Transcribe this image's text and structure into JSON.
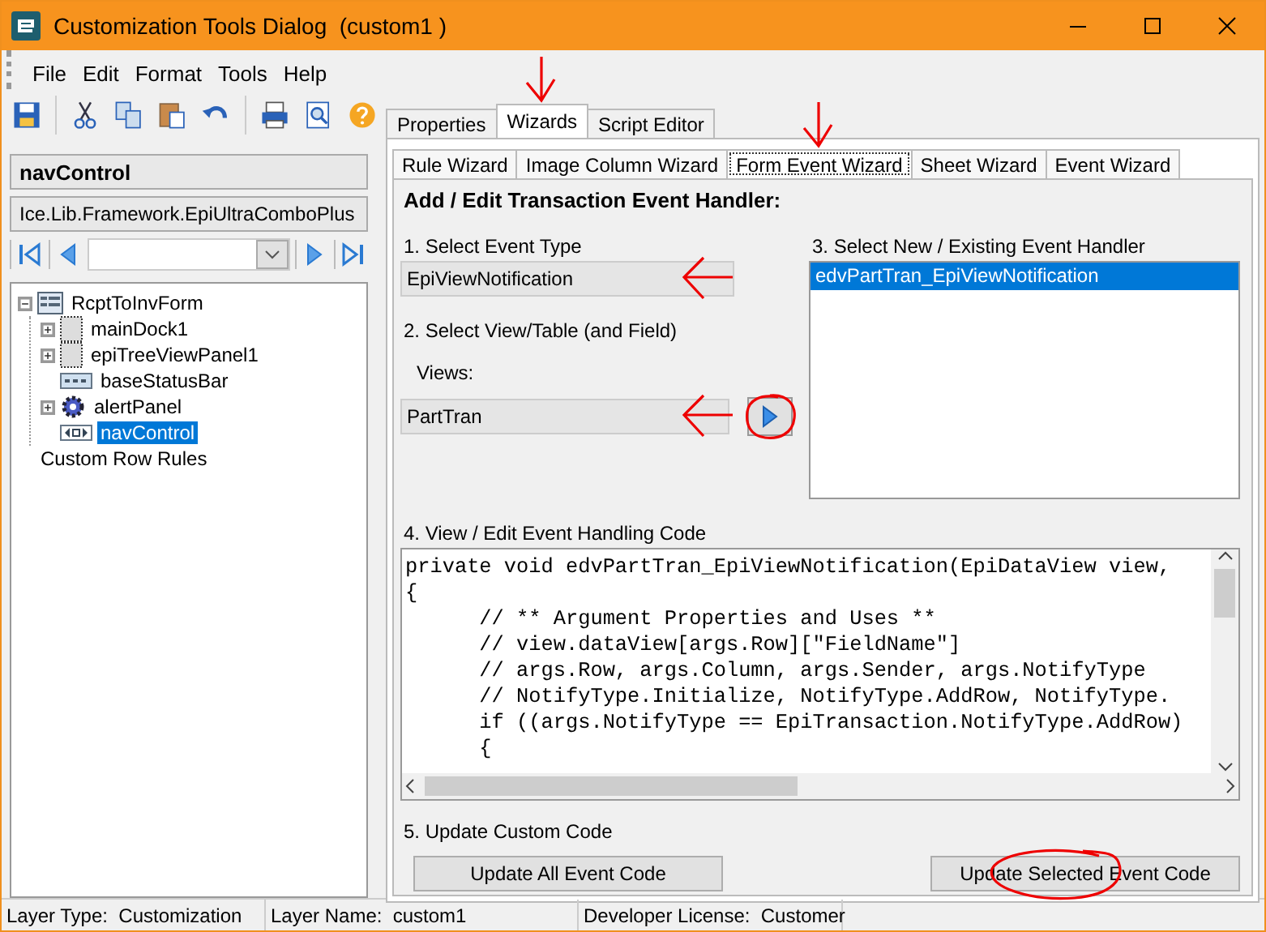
{
  "window": {
    "title": "Customization Tools Dialog  (custom1 )"
  },
  "menu": [
    "File",
    "Edit",
    "Format",
    "Tools",
    "Help"
  ],
  "left_panel": {
    "control_name": "navControl",
    "control_type": "Ice.Lib.Framework.EpiUltraComboPlus"
  },
  "tree": [
    {
      "label": "RcptToInvForm",
      "kind": "form",
      "expanded": true,
      "selected": false,
      "children": [
        {
          "label": "mainDock1",
          "kind": "panel",
          "expanded": false,
          "selected": false
        },
        {
          "label": "epiTreeViewPanel1",
          "kind": "panel",
          "expanded": false,
          "selected": false
        },
        {
          "label": "baseStatusBar",
          "kind": "statusbar",
          "selected": false
        },
        {
          "label": "alertPanel",
          "kind": "gear",
          "expanded": false,
          "selected": false
        },
        {
          "label": "navControl",
          "kind": "nav",
          "selected": true
        }
      ]
    },
    {
      "label": "Custom Row Rules",
      "kind": "text",
      "selected": false
    }
  ],
  "tabs": [
    {
      "label": "Properties",
      "selected": false,
      "marked": false
    },
    {
      "label": "Wizards",
      "selected": true,
      "marked": true
    },
    {
      "label": "Script Editor",
      "selected": false,
      "marked": false
    }
  ],
  "wizard_tabs": [
    {
      "label": "Rule Wizard",
      "selected": false,
      "marked": false
    },
    {
      "label": "Image Column Wizard",
      "selected": false,
      "marked": false
    },
    {
      "label": "Form Event Wizard",
      "selected": true,
      "marked": true
    },
    {
      "label": "Sheet Wizard",
      "selected": false,
      "marked": false
    },
    {
      "label": "Event Wizard",
      "selected": false,
      "marked": false
    }
  ],
  "wizard": {
    "heading": "Add / Edit Transaction Event Handler:",
    "event_type_label": "1. Select Event Type",
    "event_type": {
      "value": "EpiViewNotification",
      "marked": true
    },
    "view_label": "2. Select View/Table (and Field)",
    "views_label": "Views:",
    "views": {
      "value": "PartTran",
      "marked": true
    },
    "add_button_circled": true,
    "handler_label": "3. Select New / Existing Event Handler",
    "handlers": [
      {
        "label": "edvPartTran_EpiViewNotification",
        "selected": true
      }
    ],
    "code_label": "4. View / Edit Event Handling Code",
    "code_lines": [
      "private void edvPartTran_EpiViewNotification(EpiDataView view,",
      "{",
      "      // ** Argument Properties and Uses **",
      "      // view.dataView[args.Row][\"FieldName\"]",
      "      // args.Row, args.Column, args.Sender, args.NotifyType",
      "      // NotifyType.Initialize, NotifyType.AddRow, NotifyType.",
      "      if ((args.NotifyType == EpiTransaction.NotifyType.AddRow)",
      "      {"
    ],
    "update_label": "5. Update Custom Code",
    "buttons": [
      {
        "label": "Update All Event Code",
        "circled": false
      },
      {
        "label": "Update Selected Event Code",
        "circled": true
      }
    ]
  },
  "status_bar": [
    "Layer Type:  Customization",
    "Layer Name:  custom1",
    "Developer License:  Customer"
  ]
}
